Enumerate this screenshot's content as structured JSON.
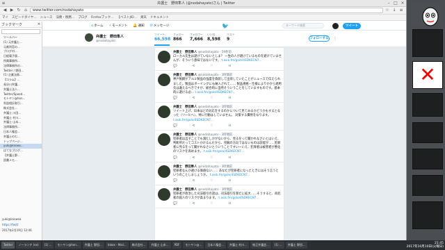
{
  "window": {
    "title": "弁護士　野田隼人 (@nodahayato)さん | Twitter"
  },
  "address": {
    "url": "www.twitter.com/nodahayato"
  },
  "bookmarks": [
    "マイ",
    "スピードダイヤ...",
    "ニュース",
    "法務・税務...",
    "ブログ",
    "Firefoxブック...",
    "【ベストJID...",
    "楽天",
    "ドキュメント"
  ],
  "sidebar": {
    "title": "ブックマーク",
    "items": [
      "ツールバー",
      "(1) 元弁護士...",
      "元裁判官の...",
      "ブログ村...",
      "日経電子版...",
      "所属事務所...",
      "法律事務所の...",
      "Twitter / 野田...",
      "(1) 企業法務...",
      "【コラム】...",
      "長谷川弁護...",
      "弁護士法人...",
      "Twitter/Speed...",
      "モトヤン@hon...",
      "利益相反取引...",
      "株式会社...",
      "弁護士 川田...",
      "弁護士 村川...",
      "弁護士 山本...",
      "法律事務所...",
      "日本人権会...",
      "弁護士のむ...",
      "トップページ...",
      "yuki@knows...",
      "はてなブログ...",
      "【弁護士野...",
      "読書メモ..."
    ],
    "selected_index": 23,
    "bottom_label": "yuki@knowsa",
    "bottom_link": "https://twitt",
    "date": "2017年2月19日 12:46"
  },
  "twitter_nav": {
    "tabs": [
      {
        "label": "ホーム",
        "icon": "home-icon"
      },
      {
        "label": "モーメント",
        "icon": "lightning-icon"
      },
      {
        "label": "通知",
        "icon": "bell-icon"
      },
      {
        "label": "メッセージ",
        "icon": "envelope-icon"
      }
    ],
    "search_placeholder": "キーワード検索",
    "tweet_button": "ツイート"
  },
  "profile": {
    "name": "弁護士　野田隼人",
    "handle": "@nodahayato",
    "stats": [
      {
        "label": "ツイート",
        "value": "66,598"
      },
      {
        "label": "フォロー",
        "value": "866"
      },
      {
        "label": "フォロワー",
        "value": "7,666"
      },
      {
        "label": "いいね",
        "value": "8,598"
      },
      {
        "label": "リスト",
        "value": "9"
      }
    ],
    "follow_button": "フォローする"
  },
  "tweets": [
    {
      "name": "弁護士　野田隼人",
      "handle": "@nodahayato · 59秒前",
      "text": "ローカル先生は避けていないとしま？ 一生の人が避けているものを避けていませんが、そういう意味ではないです。",
      "link": "t.asik.fm/golo/4SDKECN7..."
    },
    {
      "name": "弁護士　野田隼人",
      "handle": "@nodahayato · 3時間前",
      "text": "神戸製鋼がアルミ製品の強度を偽装して出荷していたことがニュースで伝えられました。製品はボーイングにも納入されて…… 製品規格・仕様によりかから適用先は違えるべきですが、総合的に当然そういうことをしていますものです。基本的に避ける必…",
      "link": "t.asik.fm/golo/4SDKECN7..."
    },
    {
      "name": "弁護士　野田隼人",
      "handle": "@nodahayato · 3時間前",
      "text": "ツイート上げ、日本はどの対応をするのかについて見てみるかどうかもするとなった（ツーヒヘ）、特に行動はしていません。\n対策する費用をなります。",
      "link": "t.asik.fm/golo/4SDKECN7..."
    },
    {
      "name": "弁護士　野田隼人",
      "handle": "@nodahayato · 3時間前",
      "text": "犯罪者は出すことでも満たしかがないから、見るをって聞かれなさいとはいえ、判断所だってコストかけるんだから、見解の方向ではないものは前提が……犯罪者に見るをって聞かれなさいとういうことですいーいえ、犯罪者は被害者が悪化のリスクを高めます。",
      "link": "t.asik.fm/golo/4SDKECN7..."
    },
    {
      "name": "弁護士　野田隼人",
      "handle": "@nodahayato · 3時間前",
      "text": "犯罪者なんか避ける価値ない…… あなたが犯罪者になったときにはそう言うというのことしましょうか。",
      "link": "t.asik.fm/golo/4SDKECN7..."
    },
    {
      "name": "弁護士　野田隼人",
      "handle": "@nodahayato · 3時間前",
      "text": "犯罪者が政治した司法取引の話は、司法取引を新たに拡大……そうすると、再犯者の殺人のリスクが高まります。",
      "link": "t.asik.fm/golo/4SDKECN7..."
    }
  ],
  "taskbar": {
    "items": [
      "Twitter",
      "ノーランチ (ex)",
      "(1) ...",
      "モトヤン@hon...",
      "弁護士 野田...",
      "Inbox - Mail...",
      "株式会社...",
      "弁護士 山本...",
      "PDF",
      "モトヤン@...",
      "日本人権会...",
      "弁護士 村川...",
      "結正弁護会...",
      "(1) ...",
      "弁護士 野田..."
    ],
    "clock_time": "21:45",
    "clock_date": "2017年10月10日(火曜日)"
  }
}
